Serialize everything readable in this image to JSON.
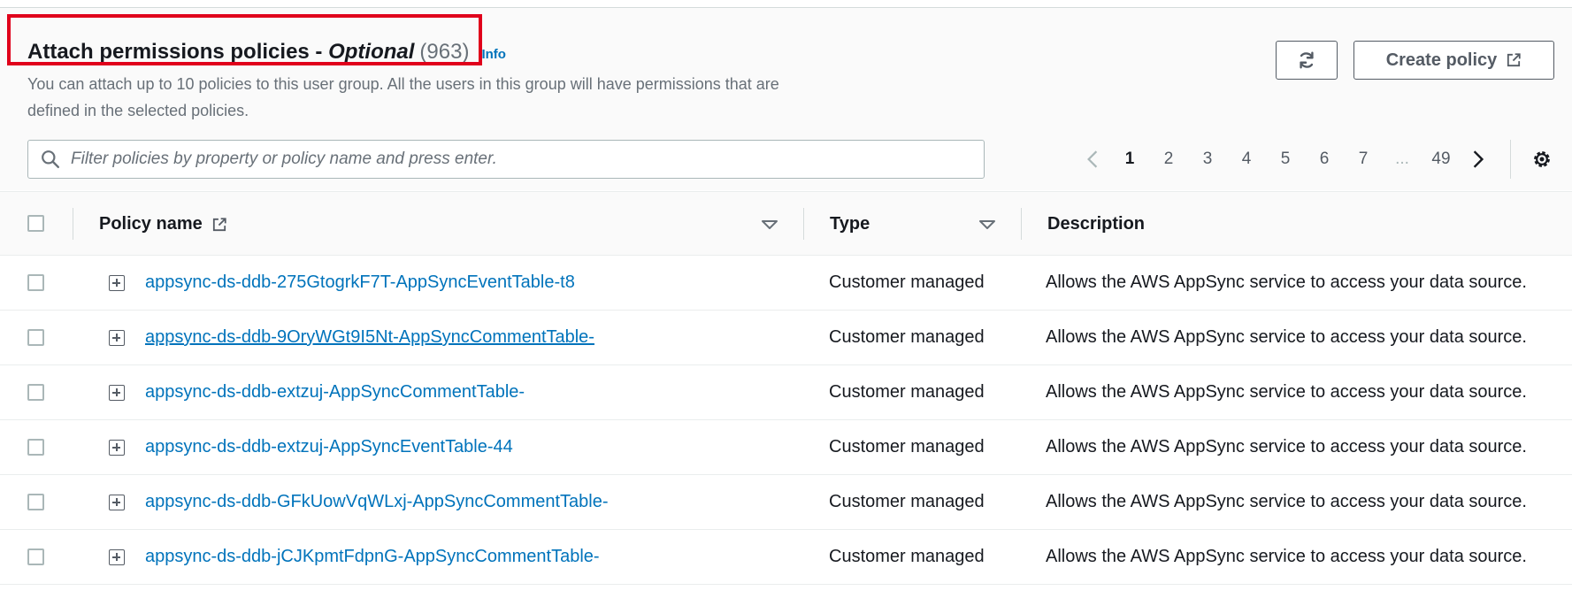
{
  "header": {
    "title_main": "Attach permissions policies - ",
    "title_optional": "Optional",
    "count": "(963)",
    "info_link": "Info",
    "description": "You can attach up to 10 policies to this user group. All the users in this group will have permissions that are defined in the selected policies.",
    "create_policy_label": "Create policy",
    "refresh_icon": "refresh-icon",
    "external_link_icon": "external-link-icon"
  },
  "search": {
    "placeholder": "Filter policies by property or policy name and press enter.",
    "icon": "search-icon"
  },
  "pagination": {
    "pages": [
      "1",
      "2",
      "3",
      "4",
      "5",
      "6",
      "7"
    ],
    "current": "1",
    "ellipsis": "...",
    "last": "49",
    "settings_icon": "gear-icon"
  },
  "table": {
    "columns": {
      "policy_name": "Policy name",
      "type": "Type",
      "description": "Description"
    },
    "rows": [
      {
        "name": "appsync-ds-ddb-275GtogrkF7T-AppSyncEventTable-t8",
        "type": "Customer managed",
        "description": "Allows the AWS AppSync service to access your data source."
      },
      {
        "name": "appsync-ds-ddb-9OryWGt9I5Nt-AppSyncCommentTable-",
        "type": "Customer managed",
        "description": "Allows the AWS AppSync service to access your data source."
      },
      {
        "name": "appsync-ds-ddb-extzuj-AppSyncCommentTable-",
        "type": "Customer managed",
        "description": "Allows the AWS AppSync service to access your data source."
      },
      {
        "name": "appsync-ds-ddb-extzuj-AppSyncEventTable-44",
        "type": "Customer managed",
        "description": "Allows the AWS AppSync service to access your data source."
      },
      {
        "name": "appsync-ds-ddb-GFkUowVqWLxj-AppSyncCommentTable-",
        "type": "Customer managed",
        "description": "Allows the AWS AppSync service to access your data source."
      },
      {
        "name": "appsync-ds-ddb-jCJKpmtFdpnG-AppSyncCommentTable-",
        "type": "Customer managed",
        "description": "Allows the AWS AppSync service to access your data source."
      }
    ]
  },
  "colors": {
    "link": "#0073bb",
    "highlight": "#e0001b",
    "muted_text": "#687078"
  }
}
